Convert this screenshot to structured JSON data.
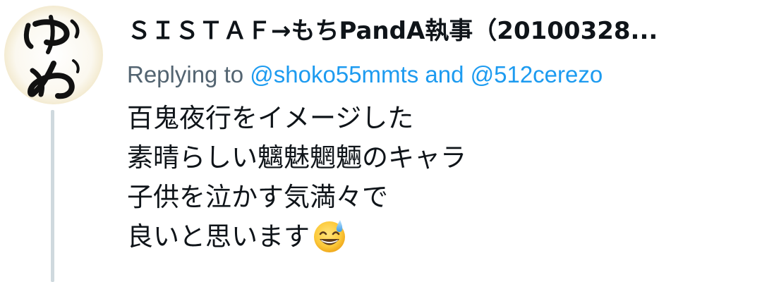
{
  "tweet": {
    "display_name": "ＳＩＳＴＡＦ→もちPandA執事（20100328...",
    "reply": {
      "prefix": "Replying to",
      "mention_1": "@shoko55mmts",
      "conjunction": "and",
      "mention_2": "@512cerezo"
    },
    "body_lines": [
      "百鬼夜行をイメージした",
      "素晴らしい魑魅魍魎のキャラ",
      "子供を泣かす気満々で",
      "良いと思います"
    ],
    "emoji": "grinning-face-with-sweat-icon"
  },
  "colors": {
    "mention": "#1d9bf0",
    "secondary_text": "#536471",
    "primary_text": "#0f1419",
    "thread_line": "#cfd9de"
  }
}
